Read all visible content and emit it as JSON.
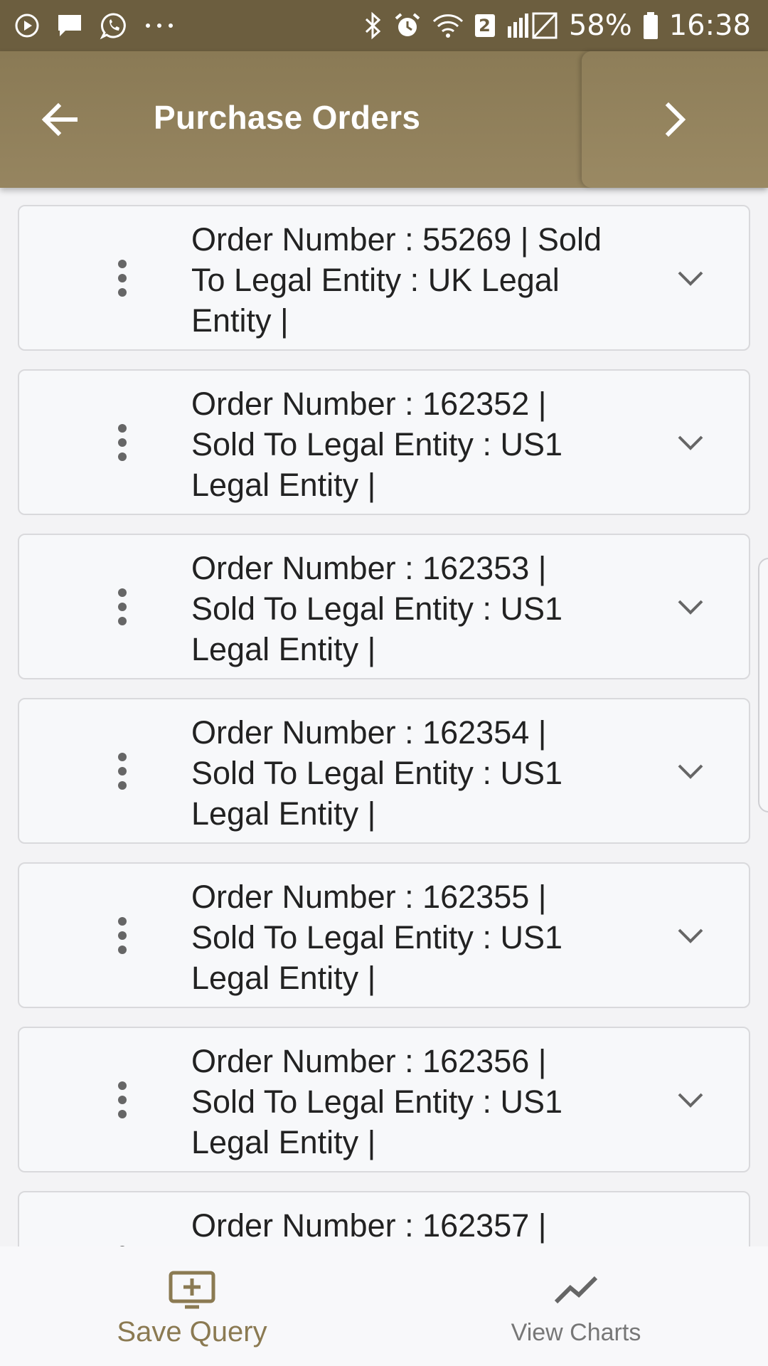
{
  "status_bar": {
    "battery": "58%",
    "time": "16:38",
    "sim_badge": "2",
    "icons": [
      "play-circle-icon",
      "chat-bubble-icon",
      "whatsapp-icon",
      "more-dots-icon",
      "bluetooth-icon",
      "alarm-icon",
      "wifi-icon",
      "signal-icon",
      "battery-icon"
    ]
  },
  "header": {
    "title": "Purchase Orders",
    "back_icon": "arrow-left-icon",
    "forward_icon": "chevron-right-icon"
  },
  "orders": [
    {
      "lines": [
        "Order Number : 55269 | Sold",
        "To Legal Entity : UK Legal",
        "Entity |"
      ]
    },
    {
      "lines": [
        "Order Number : 162352 |",
        "Sold To Legal Entity : US1",
        "Legal Entity |"
      ]
    },
    {
      "lines": [
        "Order Number : 162353 |",
        "Sold To Legal Entity : US1",
        "Legal Entity |"
      ]
    },
    {
      "lines": [
        "Order Number : 162354 |",
        "Sold To Legal Entity : US1",
        "Legal Entity |"
      ]
    },
    {
      "lines": [
        "Order Number : 162355 |",
        "Sold To Legal Entity : US1",
        "Legal Entity |"
      ]
    },
    {
      "lines": [
        "Order Number : 162356 |",
        "Sold To Legal Entity : US1",
        "Legal Entity |"
      ]
    },
    {
      "lines": [
        "Order Number : 162357 |",
        "",
        ""
      ]
    }
  ],
  "bottom_bar": {
    "save_query_label": "Save Query",
    "view_charts_label": "View Charts"
  },
  "colors": {
    "status_bar": "#6c5e3f",
    "header": "#8f7f59",
    "accent": "#8b7a52",
    "card_background": "#f7f8fa",
    "card_border": "#d9d9dc"
  }
}
